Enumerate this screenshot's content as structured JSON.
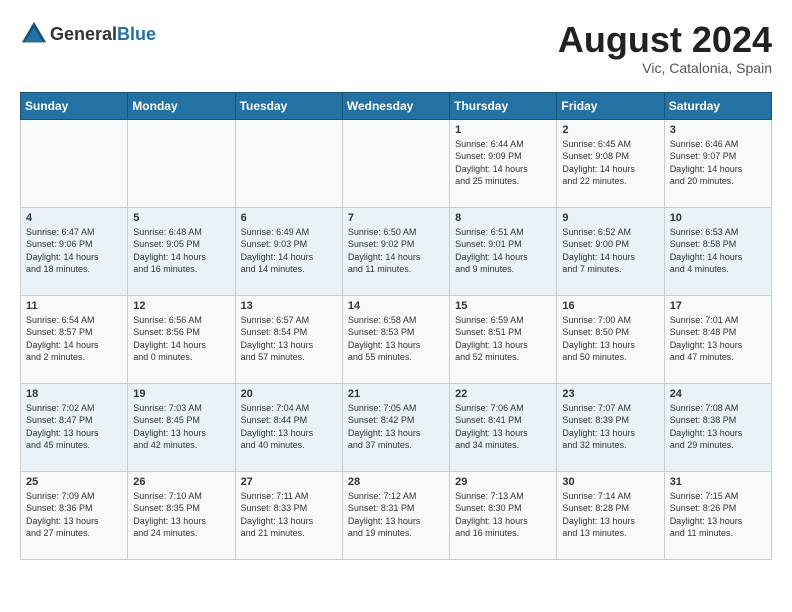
{
  "header": {
    "logo_general": "General",
    "logo_blue": "Blue",
    "month_year": "August 2024",
    "location": "Vic, Catalonia, Spain"
  },
  "calendar": {
    "days_of_week": [
      "Sunday",
      "Monday",
      "Tuesday",
      "Wednesday",
      "Thursday",
      "Friday",
      "Saturday"
    ],
    "weeks": [
      [
        {
          "day": "",
          "info": ""
        },
        {
          "day": "",
          "info": ""
        },
        {
          "day": "",
          "info": ""
        },
        {
          "day": "",
          "info": ""
        },
        {
          "day": "1",
          "info": "Sunrise: 6:44 AM\nSunset: 9:09 PM\nDaylight: 14 hours\nand 25 minutes."
        },
        {
          "day": "2",
          "info": "Sunrise: 6:45 AM\nSunset: 9:08 PM\nDaylight: 14 hours\nand 22 minutes."
        },
        {
          "day": "3",
          "info": "Sunrise: 6:46 AM\nSunset: 9:07 PM\nDaylight: 14 hours\nand 20 minutes."
        }
      ],
      [
        {
          "day": "4",
          "info": "Sunrise: 6:47 AM\nSunset: 9:06 PM\nDaylight: 14 hours\nand 18 minutes."
        },
        {
          "day": "5",
          "info": "Sunrise: 6:48 AM\nSunset: 9:05 PM\nDaylight: 14 hours\nand 16 minutes."
        },
        {
          "day": "6",
          "info": "Sunrise: 6:49 AM\nSunset: 9:03 PM\nDaylight: 14 hours\nand 14 minutes."
        },
        {
          "day": "7",
          "info": "Sunrise: 6:50 AM\nSunset: 9:02 PM\nDaylight: 14 hours\nand 11 minutes."
        },
        {
          "day": "8",
          "info": "Sunrise: 6:51 AM\nSunset: 9:01 PM\nDaylight: 14 hours\nand 9 minutes."
        },
        {
          "day": "9",
          "info": "Sunrise: 6:52 AM\nSunset: 9:00 PM\nDaylight: 14 hours\nand 7 minutes."
        },
        {
          "day": "10",
          "info": "Sunrise: 6:53 AM\nSunset: 8:58 PM\nDaylight: 14 hours\nand 4 minutes."
        }
      ],
      [
        {
          "day": "11",
          "info": "Sunrise: 6:54 AM\nSunset: 8:57 PM\nDaylight: 14 hours\nand 2 minutes."
        },
        {
          "day": "12",
          "info": "Sunrise: 6:56 AM\nSunset: 8:56 PM\nDaylight: 14 hours\nand 0 minutes."
        },
        {
          "day": "13",
          "info": "Sunrise: 6:57 AM\nSunset: 8:54 PM\nDaylight: 13 hours\nand 57 minutes."
        },
        {
          "day": "14",
          "info": "Sunrise: 6:58 AM\nSunset: 8:53 PM\nDaylight: 13 hours\nand 55 minutes."
        },
        {
          "day": "15",
          "info": "Sunrise: 6:59 AM\nSunset: 8:51 PM\nDaylight: 13 hours\nand 52 minutes."
        },
        {
          "day": "16",
          "info": "Sunrise: 7:00 AM\nSunset: 8:50 PM\nDaylight: 13 hours\nand 50 minutes."
        },
        {
          "day": "17",
          "info": "Sunrise: 7:01 AM\nSunset: 8:48 PM\nDaylight: 13 hours\nand 47 minutes."
        }
      ],
      [
        {
          "day": "18",
          "info": "Sunrise: 7:02 AM\nSunset: 8:47 PM\nDaylight: 13 hours\nand 45 minutes."
        },
        {
          "day": "19",
          "info": "Sunrise: 7:03 AM\nSunset: 8:45 PM\nDaylight: 13 hours\nand 42 minutes."
        },
        {
          "day": "20",
          "info": "Sunrise: 7:04 AM\nSunset: 8:44 PM\nDaylight: 13 hours\nand 40 minutes."
        },
        {
          "day": "21",
          "info": "Sunrise: 7:05 AM\nSunset: 8:42 PM\nDaylight: 13 hours\nand 37 minutes."
        },
        {
          "day": "22",
          "info": "Sunrise: 7:06 AM\nSunset: 8:41 PM\nDaylight: 13 hours\nand 34 minutes."
        },
        {
          "day": "23",
          "info": "Sunrise: 7:07 AM\nSunset: 8:39 PM\nDaylight: 13 hours\nand 32 minutes."
        },
        {
          "day": "24",
          "info": "Sunrise: 7:08 AM\nSunset: 8:38 PM\nDaylight: 13 hours\nand 29 minutes."
        }
      ],
      [
        {
          "day": "25",
          "info": "Sunrise: 7:09 AM\nSunset: 8:36 PM\nDaylight: 13 hours\nand 27 minutes."
        },
        {
          "day": "26",
          "info": "Sunrise: 7:10 AM\nSunset: 8:35 PM\nDaylight: 13 hours\nand 24 minutes."
        },
        {
          "day": "27",
          "info": "Sunrise: 7:11 AM\nSunset: 8:33 PM\nDaylight: 13 hours\nand 21 minutes."
        },
        {
          "day": "28",
          "info": "Sunrise: 7:12 AM\nSunset: 8:31 PM\nDaylight: 13 hours\nand 19 minutes."
        },
        {
          "day": "29",
          "info": "Sunrise: 7:13 AM\nSunset: 8:30 PM\nDaylight: 13 hours\nand 16 minutes."
        },
        {
          "day": "30",
          "info": "Sunrise: 7:14 AM\nSunset: 8:28 PM\nDaylight: 13 hours\nand 13 minutes."
        },
        {
          "day": "31",
          "info": "Sunrise: 7:15 AM\nSunset: 8:26 PM\nDaylight: 13 hours\nand 11 minutes."
        }
      ]
    ]
  }
}
